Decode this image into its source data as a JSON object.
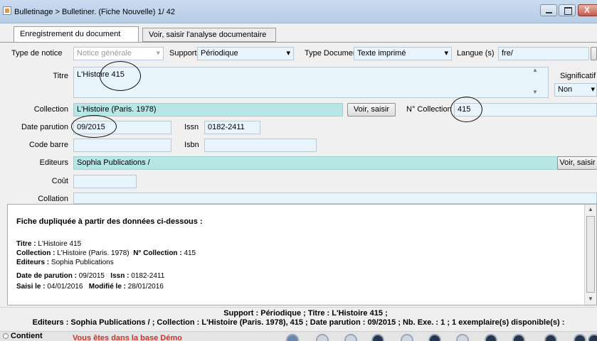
{
  "window": {
    "title": "Bulletinage > Bulletiner. (Fiche Nouvelle)   1/  42",
    "close_label": "X"
  },
  "tabs": [
    {
      "label": "Enregistrement du document"
    },
    {
      "label": "Voir, saisir l'analyse documentaire"
    }
  ],
  "form": {
    "type_notice_label": "Type  de notice",
    "type_notice_value": "Notice générale",
    "support_label": "Support",
    "support_value": "Périodique",
    "type_document_label": "Type Document",
    "type_document_value": "Texte imprimé",
    "langue_label": "Langue (s)",
    "langue_value": "fre/",
    "titre_label": "Titre",
    "titre_value": "L'Histoire 415",
    "significatif_label": "Significatif",
    "significatif_value": "Non",
    "collection_label": "Collection",
    "collection_value": "L'Histoire (Paris. 1978)",
    "voir_saisir_label": "Voir, saisir",
    "n_collection_label": "N° Collection",
    "n_collection_value": "415",
    "date_parution_label": "Date parution",
    "date_parution_value": "09/2015",
    "issn_label": "Issn",
    "issn_value": "0182-2411",
    "code_barre_label": "Code barre",
    "isbn_label": "Isbn",
    "editeurs_label": "Editeurs",
    "editeurs_value": "Sophia Publications /",
    "editeurs_button": "Voir, saisir",
    "cout_label": "Coût",
    "collation_label": "Collation"
  },
  "info": {
    "heading": "Fiche dupliquée à partir des données ci-dessous :",
    "titre_key": "Titre :",
    "titre_val": "L'Histoire 415",
    "collection_key": "Collection :",
    "collection_val": "L'Histoire (Paris. 1978)",
    "ncoll_key": "N° Collection :",
    "ncoll_val": "415",
    "editeurs_key": "Editeurs :",
    "editeurs_val": "Sophia Publications",
    "date_key": "Date de parution :",
    "date_val": "09/2015",
    "issn_key": "Issn :",
    "issn_val": "0182-2411",
    "saisi_key": "Saisi le :",
    "saisi_val": "04/01/2016",
    "modifie_key": "Modifié le :",
    "modifie_val": "28/01/2016"
  },
  "status": {
    "line1": "Support  : Périodique ;  Titre  : L'Histoire 415 ;",
    "line2": "Editeurs  : Sophia Publications / ;  Collection  : L'Histoire (Paris. 1978), 415 ;  Date parution  : 09/2015 ;  Nb. Exe.  : 1 ; 1 exemplaire(s) disponible(s)  :"
  },
  "bottom": {
    "contient_label": "Contient",
    "demo_message": "Vous êtes dans la base Démo"
  },
  "colors": {
    "teal_field": "#b6e6e6",
    "light_field": "#e8f4fb",
    "demo_text": "#c0392b"
  }
}
